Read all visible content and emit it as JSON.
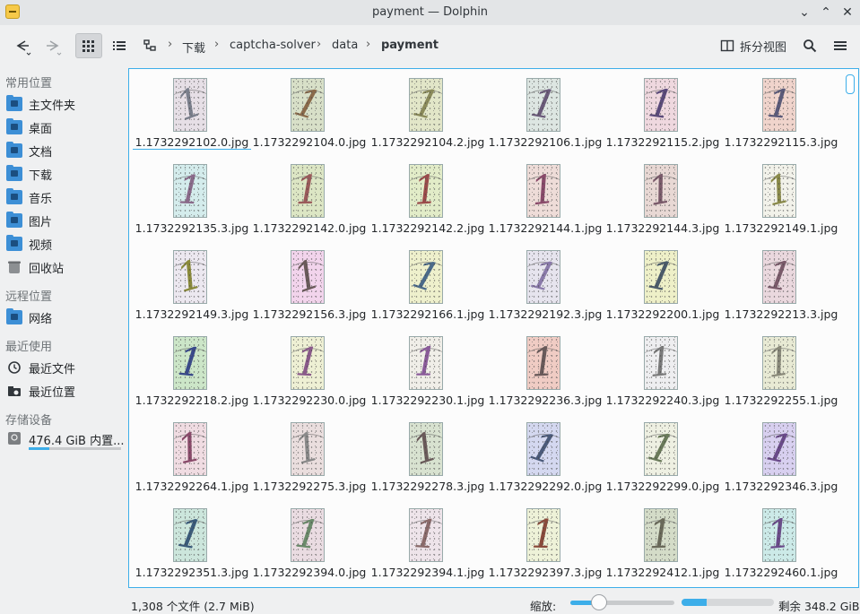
{
  "window": {
    "title": "payment — Dolphin"
  },
  "toolbar": {
    "breadcrumb": [
      "下载",
      "captcha-solver",
      "data",
      "payment"
    ],
    "split_label": "拆分视图"
  },
  "sidebar": {
    "places_header": "常用位置",
    "places": [
      {
        "label": "主文件夹",
        "icon": "home-icon"
      },
      {
        "label": "桌面",
        "icon": "desktop-icon"
      },
      {
        "label": "文档",
        "icon": "documents-icon"
      },
      {
        "label": "下载",
        "icon": "downloads-icon"
      },
      {
        "label": "音乐",
        "icon": "music-icon"
      },
      {
        "label": "图片",
        "icon": "pictures-icon"
      },
      {
        "label": "视频",
        "icon": "videos-icon"
      },
      {
        "label": "回收站",
        "icon": "trash-icon"
      }
    ],
    "remote_header": "远程位置",
    "remote": [
      {
        "label": "网络",
        "icon": "network-icon"
      }
    ],
    "recent_header": "最近使用",
    "recent": [
      {
        "label": "最近文件",
        "icon": "clock-icon"
      },
      {
        "label": "最近位置",
        "icon": "recent-locations-icon"
      }
    ],
    "devices_header": "存储设备",
    "devices": [
      {
        "label": "476.4 GiB 内置...",
        "icon": "drive-icon",
        "usage": 0.22
      }
    ]
  },
  "files": [
    {
      "name": "1.1732292102.0.jpg",
      "bg": "#e6dfe6",
      "fg": "#7a7f8c"
    },
    {
      "name": "1.1732292104.0.jpg",
      "bg": "#d8e0c8",
      "fg": "#8a6a4a"
    },
    {
      "name": "1.1732292104.2.jpg",
      "bg": "#e2e6c8",
      "fg": "#8a8a5a"
    },
    {
      "name": "1.1732292106.1.jpg",
      "bg": "#dde6e2",
      "fg": "#6a5a7a"
    },
    {
      "name": "1.1732292115.2.jpg",
      "bg": "#efd8df",
      "fg": "#5a4a7a"
    },
    {
      "name": "1.1732292115.3.jpg",
      "bg": "#f0d4cc",
      "fg": "#5a5a7a"
    },
    {
      "name": "1.1732292135.3.jpg",
      "bg": "#d4ecec",
      "fg": "#8a6a8a"
    },
    {
      "name": "1.1732292142.0.jpg",
      "bg": "#dce6c4",
      "fg": "#9a5a5a"
    },
    {
      "name": "1.1732292142.2.jpg",
      "bg": "#e2ecc8",
      "fg": "#9a4a4a"
    },
    {
      "name": "1.1732292144.1.jpg",
      "bg": "#eedcd8",
      "fg": "#8a4a6a"
    },
    {
      "name": "1.1732292144.3.jpg",
      "bg": "#e8d8d4",
      "fg": "#7a5a6a"
    },
    {
      "name": "1.1732292149.1.jpg",
      "bg": "#f2f2ea",
      "fg": "#8a8a4a"
    },
    {
      "name": "1.1732292149.3.jpg",
      "bg": "#ece8f0",
      "fg": "#8a8a3a"
    },
    {
      "name": "1.1732292156.3.jpg",
      "bg": "#f2d4ec",
      "fg": "#6a5a5a"
    },
    {
      "name": "1.1732292166.1.jpg",
      "bg": "#eef0cc",
      "fg": "#4a6a8a"
    },
    {
      "name": "1.1732292192.3.jpg",
      "bg": "#e6e4ee",
      "fg": "#8a7aaa"
    },
    {
      "name": "1.1732292200.1.jpg",
      "bg": "#eef0c8",
      "fg": "#4a5a6a"
    },
    {
      "name": "1.1732292213.3.jpg",
      "bg": "#ead8de",
      "fg": "#7a5a6a"
    },
    {
      "name": "1.1732292218.2.jpg",
      "bg": "#cce6c8",
      "fg": "#3a4a8a"
    },
    {
      "name": "1.1732292230.0.jpg",
      "bg": "#eef0d4",
      "fg": "#8a5a8a"
    },
    {
      "name": "1.1732292230.1.jpg",
      "bg": "#f0eee8",
      "fg": "#8a5a9a"
    },
    {
      "name": "1.1732292236.3.jpg",
      "bg": "#f0ccc4",
      "fg": "#6a5a5a"
    },
    {
      "name": "1.1732292240.3.jpg",
      "bg": "#eeeef0",
      "fg": "#7a7a7a"
    },
    {
      "name": "1.1732292255.1.jpg",
      "bg": "#e8ead4",
      "fg": "#8a8a7a"
    },
    {
      "name": "1.1732292264.1.jpg",
      "bg": "#f0dce2",
      "fg": "#8a4a6a"
    },
    {
      "name": "1.1732292275.3.jpg",
      "bg": "#eadede",
      "fg": "#8a8a8a"
    },
    {
      "name": "1.1732292278.3.jpg",
      "bg": "#d8e2d0",
      "fg": "#6a5a5a"
    },
    {
      "name": "1.1732292292.0.jpg",
      "bg": "#d4d8f0",
      "fg": "#4a5a7a"
    },
    {
      "name": "1.1732292299.0.jpg",
      "bg": "#eef0e2",
      "fg": "#6a7a5a"
    },
    {
      "name": "1.1732292346.3.jpg",
      "bg": "#d8d0f0",
      "fg": "#6a4a8a"
    },
    {
      "name": "1.1732292351.3.jpg",
      "bg": "#cce6dc",
      "fg": "#3a5a7a"
    },
    {
      "name": "1.1732292394.0.jpg",
      "bg": "#eadce2",
      "fg": "#6a8a6a"
    },
    {
      "name": "1.1732292394.1.jpg",
      "bg": "#eee4ea",
      "fg": "#8a6a6a"
    },
    {
      "name": "1.1732292397.3.jpg",
      "bg": "#eef2d8",
      "fg": "#8a4a3a"
    },
    {
      "name": "1.1732292412.1.jpg",
      "bg": "#d4dcc8",
      "fg": "#6a6a5a"
    },
    {
      "name": "1.1732292460.1.jpg",
      "bg": "#cceae8",
      "fg": "#6a4a8a"
    }
  ],
  "statusbar": {
    "summary": "1,308 个文件 (2.7 MiB)",
    "zoom_label": "缩放:",
    "zoom_level": 0.28,
    "free_space_used_fraction": 0.27,
    "free_space_text": "剩余 348.2 GiB"
  }
}
